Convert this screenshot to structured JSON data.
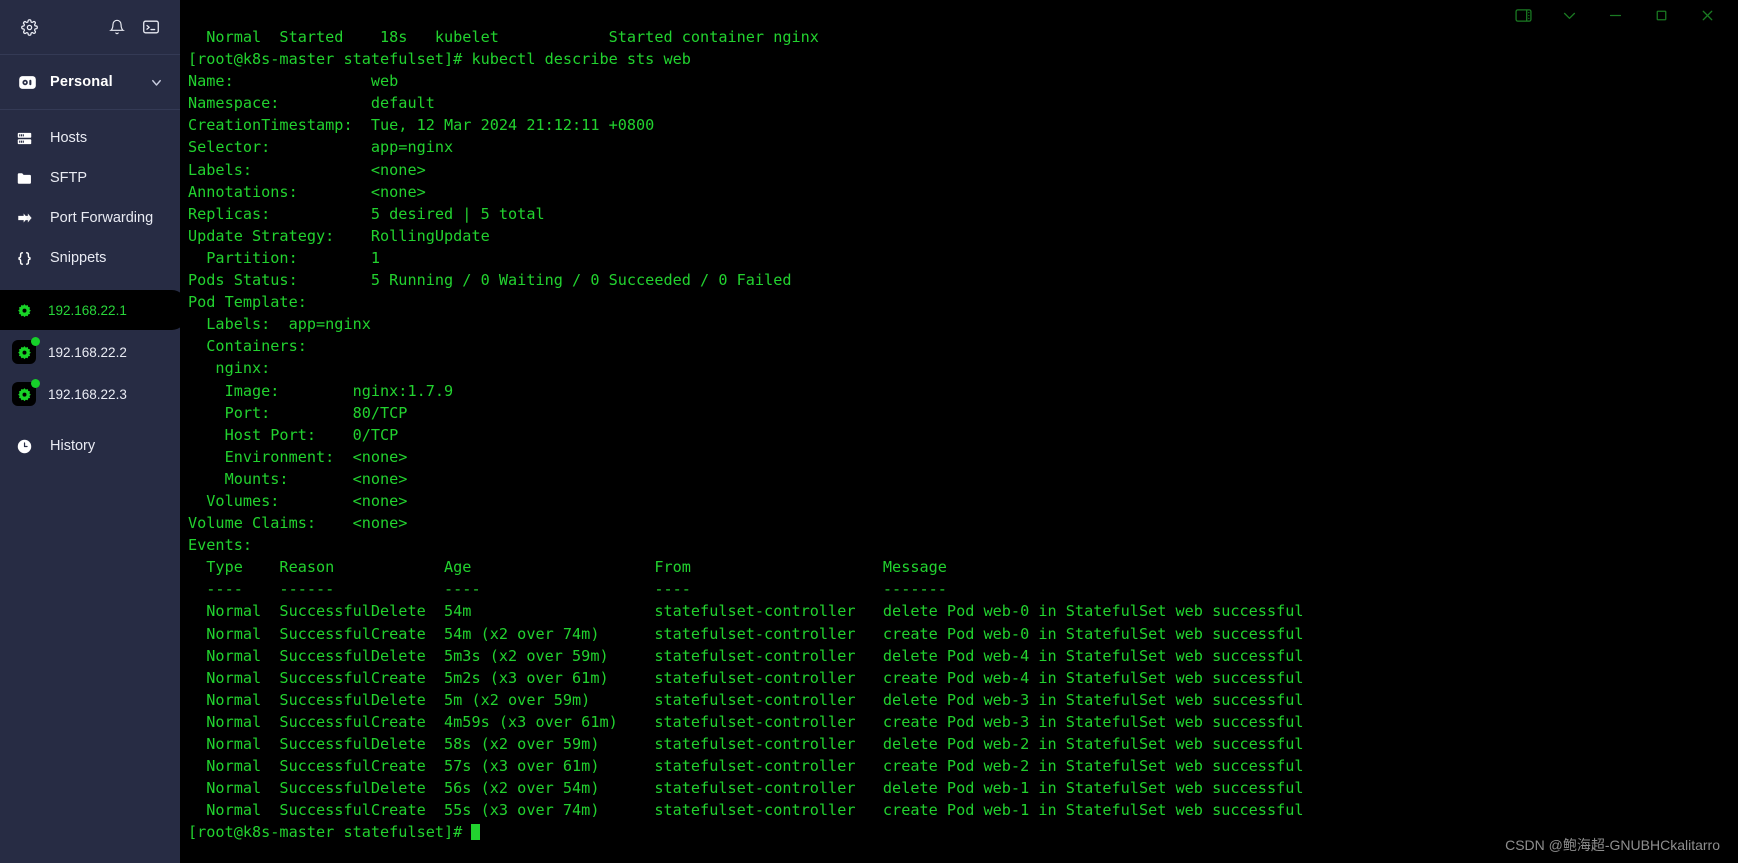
{
  "sidebar": {
    "toolbar": {
      "settings_icon": "gear-icon",
      "notifications_icon": "bell-icon",
      "terminal_icon": "terminal-icon"
    },
    "workspace": {
      "label": "Personal",
      "icon": "vault-icon",
      "chevron": "chevron-down-icon"
    },
    "nav_items": [
      {
        "label": "Hosts",
        "icon": "server-icon"
      },
      {
        "label": "SFTP",
        "icon": "folder-icon"
      },
      {
        "label": "Port Forwarding",
        "icon": "arrows-icon"
      },
      {
        "label": "Snippets",
        "icon": "braces-icon"
      }
    ],
    "hosts": [
      {
        "label": "192.168.22.1",
        "icon": "gear-icon",
        "active": true,
        "online": false
      },
      {
        "label": "192.168.22.2",
        "icon": "gear-icon",
        "active": false,
        "online": true
      },
      {
        "label": "192.168.22.3",
        "icon": "gear-icon",
        "active": false,
        "online": true
      }
    ],
    "history": {
      "label": "History",
      "icon": "clock-icon"
    }
  },
  "titlebar": {
    "buttons": [
      {
        "name": "split-pane-icon",
        "glyph": "split"
      },
      {
        "name": "chevron-down-icon",
        "glyph": "chevron"
      },
      {
        "name": "minimize-icon",
        "glyph": "minimize"
      },
      {
        "name": "maximize-icon",
        "glyph": "maximize"
      },
      {
        "name": "close-icon",
        "glyph": "close"
      }
    ]
  },
  "terminal": {
    "prompt": "[root@k8s-master statefulset]#",
    "command": "kubectl describe sts web",
    "lines": [
      "  Normal  Started    18s   kubelet            Started container nginx",
      "[root@k8s-master statefulset]# kubectl describe sts web",
      "Name:               web",
      "Namespace:          default",
      "CreationTimestamp:  Tue, 12 Mar 2024 21:12:11 +0800",
      "Selector:           app=nginx",
      "Labels:             <none>",
      "Annotations:        <none>",
      "Replicas:           5 desired | 5 total",
      "Update Strategy:    RollingUpdate",
      "  Partition:        1",
      "Pods Status:        5 Running / 0 Waiting / 0 Succeeded / 0 Failed",
      "Pod Template:",
      "  Labels:  app=nginx",
      "  Containers:",
      "   nginx:",
      "    Image:        nginx:1.7.9",
      "    Port:         80/TCP",
      "    Host Port:    0/TCP",
      "    Environment:  <none>",
      "    Mounts:       <none>",
      "  Volumes:        <none>",
      "Volume Claims:    <none>",
      "Events:",
      "  Type    Reason            Age                    From                     Message",
      "  ----    ------            ----                   ----                     -------",
      "  Normal  SuccessfulDelete  54m                    statefulset-controller   delete Pod web-0 in StatefulSet web successful",
      "  Normal  SuccessfulCreate  54m (x2 over 74m)      statefulset-controller   create Pod web-0 in StatefulSet web successful",
      "  Normal  SuccessfulDelete  5m3s (x2 over 59m)     statefulset-controller   delete Pod web-4 in StatefulSet web successful",
      "  Normal  SuccessfulCreate  5m2s (x3 over 61m)     statefulset-controller   create Pod web-4 in StatefulSet web successful",
      "  Normal  SuccessfulDelete  5m (x2 over 59m)       statefulset-controller   delete Pod web-3 in StatefulSet web successful",
      "  Normal  SuccessfulCreate  4m59s (x3 over 61m)    statefulset-controller   create Pod web-3 in StatefulSet web successful",
      "  Normal  SuccessfulDelete  58s (x2 over 59m)      statefulset-controller   delete Pod web-2 in StatefulSet web successful",
      "  Normal  SuccessfulCreate  57s (x3 over 61m)      statefulset-controller   create Pod web-2 in StatefulSet web successful",
      "  Normal  SuccessfulDelete  56s (x2 over 54m)      statefulset-controller   delete Pod web-1 in StatefulSet web successful",
      "  Normal  SuccessfulCreate  55s (x3 over 74m)      statefulset-controller   create Pod web-1 in StatefulSet web successful"
    ],
    "last_prompt": "[root@k8s-master statefulset]# "
  },
  "watermark": "CSDN @鲍海超-GNUBHCkalitarro",
  "colors": {
    "sidebar_bg": "#272c44",
    "terminal_bg": "#000000",
    "terminal_fg": "#22d22f",
    "accent_green": "#28d63a",
    "window_btn": "#1a7a22"
  }
}
